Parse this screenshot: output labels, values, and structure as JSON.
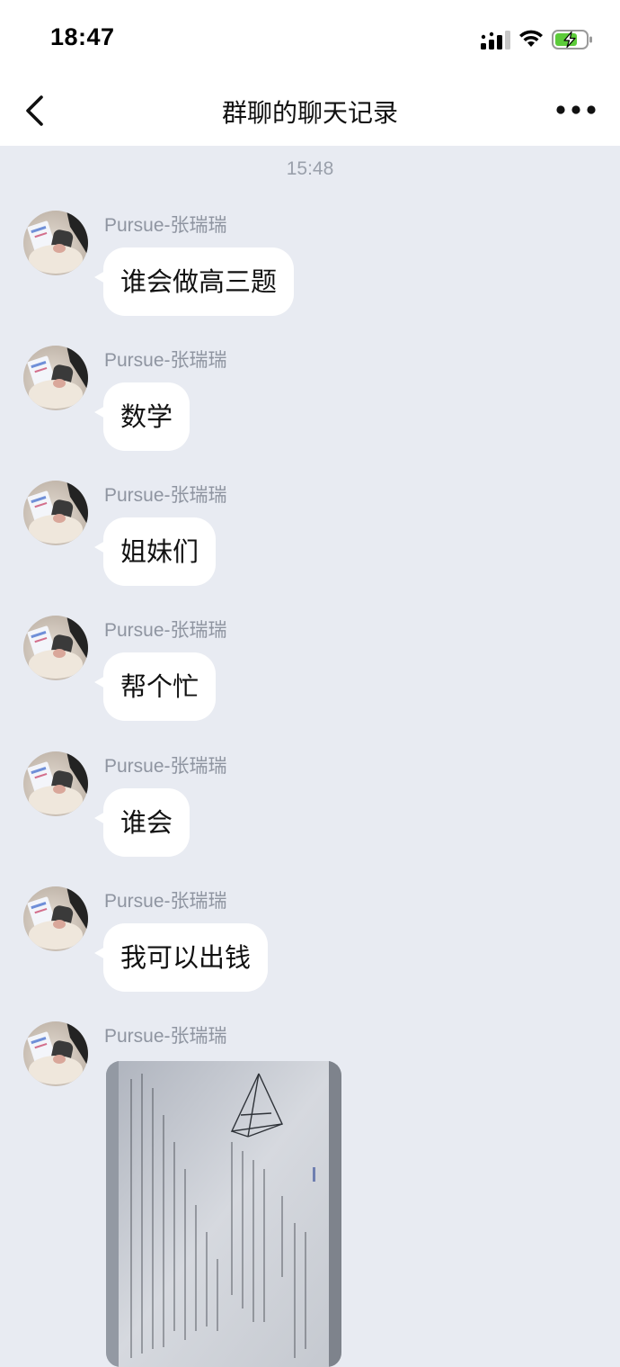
{
  "status_bar": {
    "time": "18:47"
  },
  "nav": {
    "title": "群聊的聊天记录"
  },
  "chat": {
    "timestamp": "15:48",
    "messages": [
      {
        "sender": "Pursue-张瑞瑞",
        "text": "谁会做高三题"
      },
      {
        "sender": "Pursue-张瑞瑞",
        "text": "数学"
      },
      {
        "sender": "Pursue-张瑞瑞",
        "text": "姐妹们"
      },
      {
        "sender": "Pursue-张瑞瑞",
        "text": "帮个忙"
      },
      {
        "sender": "Pursue-张瑞瑞",
        "text": "谁会"
      },
      {
        "sender": "Pursue-张瑞瑞",
        "text": "我可以出钱"
      },
      {
        "sender": "Pursue-张瑞瑞"
      }
    ]
  },
  "colors": {
    "chat_background": "#e8ebf2",
    "bubble": "#ffffff",
    "sender_text": "#8f95a1",
    "battery_fill": "#5ccb3a"
  },
  "icons": {
    "back": "chevron-left-icon",
    "more": "more-dots-icon",
    "signal": "cellular-signal-icon",
    "wifi": "wifi-icon",
    "battery": "battery-charging-icon"
  }
}
